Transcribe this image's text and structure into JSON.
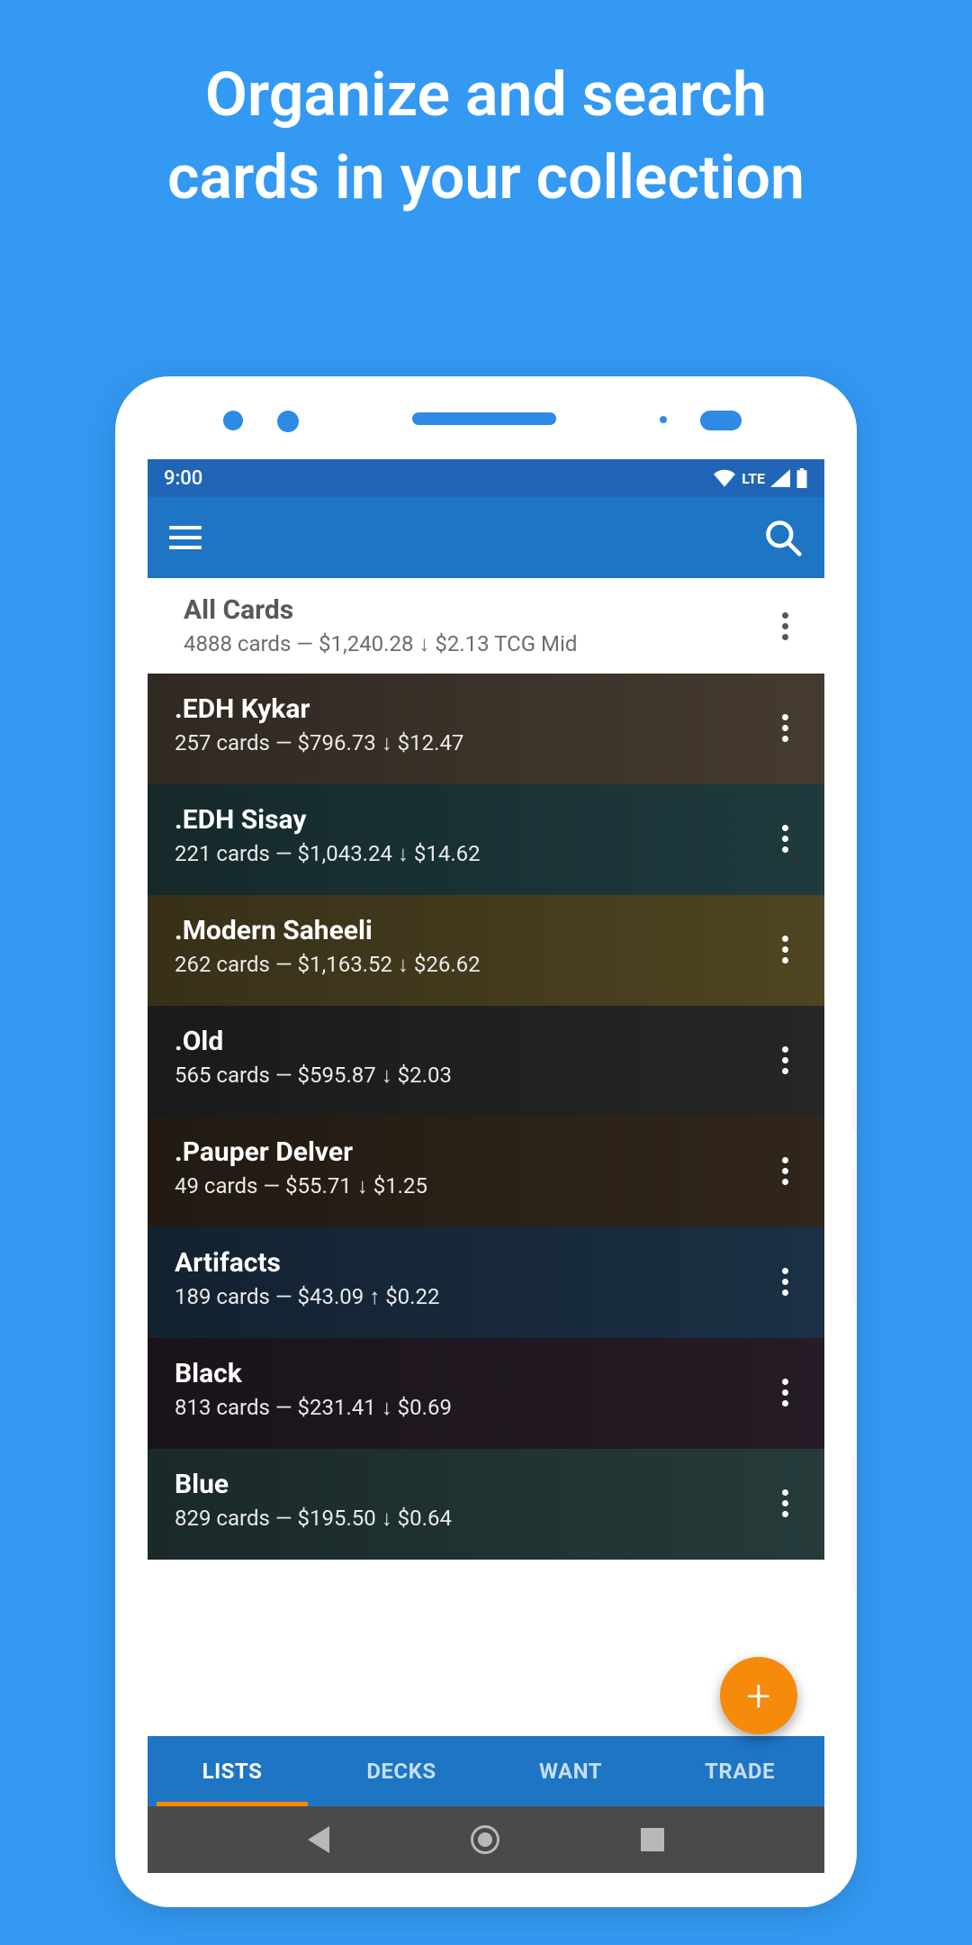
{
  "hero": {
    "line1": "Organize and search",
    "line2": "cards in your collection"
  },
  "statusbar": {
    "time": "9:00",
    "network": "LTE"
  },
  "header": {
    "title": "All Cards",
    "subtitle": "4888 cards — $1,240.28 ↓ $2.13 TCG Mid"
  },
  "lists": [
    {
      "title": ".EDH Kykar",
      "sub": "257 cards — $796.73 ↓ $12.47"
    },
    {
      "title": ".EDH Sisay",
      "sub": "221 cards — $1,043.24 ↓ $14.62"
    },
    {
      "title": ".Modern Saheeli",
      "sub": "262 cards — $1,163.52 ↓ $26.62"
    },
    {
      "title": ".Old",
      "sub": "565 cards — $595.87 ↓ $2.03"
    },
    {
      "title": ".Pauper Delver",
      "sub": "49 cards — $55.71 ↓ $1.25"
    },
    {
      "title": "Artifacts",
      "sub": "189 cards — $43.09 ↑ $0.22"
    },
    {
      "title": "Black",
      "sub": "813 cards — $231.41 ↓ $0.69"
    },
    {
      "title": "Blue",
      "sub": "829 cards — $195.50 ↓ $0.64"
    }
  ],
  "tabs": [
    {
      "label": "LISTS",
      "active": true
    },
    {
      "label": "DECKS",
      "active": false
    },
    {
      "label": "WANT",
      "active": false
    },
    {
      "label": "TRADE",
      "active": false
    }
  ],
  "fab": {
    "symbol": "+"
  }
}
